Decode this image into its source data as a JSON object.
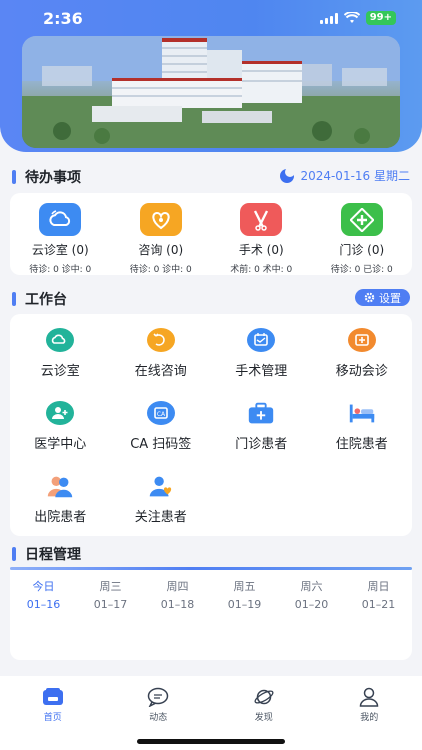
{
  "status_bar": {
    "time": "2:36",
    "battery": "99+"
  },
  "pending": {
    "title": "待办事项",
    "date": "2024-01-16 星期二",
    "items": [
      {
        "label": "云诊室 (0)",
        "sub": "待诊: 0 诊中: 0",
        "icon": "cloud-consult-icon",
        "color": "#3d8bf2"
      },
      {
        "label": "咨询 (0)",
        "sub": "待诊: 0 诊中: 0",
        "icon": "consult-heart-icon",
        "color": "#f6a623"
      },
      {
        "label": "手术 (0)",
        "sub": "术前: 0 术中: 0",
        "icon": "surgery-tools-icon",
        "color": "#ef5a5a"
      },
      {
        "label": "门诊 (0)",
        "sub": "待诊: 0 已诊: 0",
        "icon": "outpatient-cross-icon",
        "color": "#3cbf4a"
      }
    ]
  },
  "workbench": {
    "title": "工作台",
    "settings_label": "设置",
    "items": [
      {
        "label": "云诊室",
        "icon": "cloud-room-icon"
      },
      {
        "label": "在线咨询",
        "icon": "online-consult-icon"
      },
      {
        "label": "手术管理",
        "icon": "surgery-manage-icon"
      },
      {
        "label": "移动会诊",
        "icon": "mobile-consult-icon"
      },
      {
        "label": "医学中心",
        "icon": "medical-center-icon"
      },
      {
        "label": "CA 扫码签",
        "icon": "ca-scan-icon"
      },
      {
        "label": "门诊患者",
        "icon": "outpatient-patients-icon"
      },
      {
        "label": "住院患者",
        "icon": "inpatient-icon"
      },
      {
        "label": "出院患者",
        "icon": "discharged-icon"
      },
      {
        "label": "关注患者",
        "icon": "followed-patients-icon"
      }
    ]
  },
  "schedule": {
    "title": "日程管理",
    "days": [
      {
        "name": "今日",
        "date": "01–16",
        "active": true
      },
      {
        "name": "周三",
        "date": "01–17"
      },
      {
        "name": "周四",
        "date": "01–18"
      },
      {
        "name": "周五",
        "date": "01–19"
      },
      {
        "name": "周六",
        "date": "01–20"
      },
      {
        "name": "周日",
        "date": "01–21"
      }
    ]
  },
  "tabs": [
    {
      "label": "首页",
      "icon": "home-icon",
      "active": true
    },
    {
      "label": "动态",
      "icon": "chat-bubble-icon"
    },
    {
      "label": "发现",
      "icon": "planet-icon"
    },
    {
      "label": "我的",
      "icon": "user-icon"
    }
  ],
  "colors": {
    "accent": "#4f7ef3",
    "header": "#5a86f4"
  }
}
